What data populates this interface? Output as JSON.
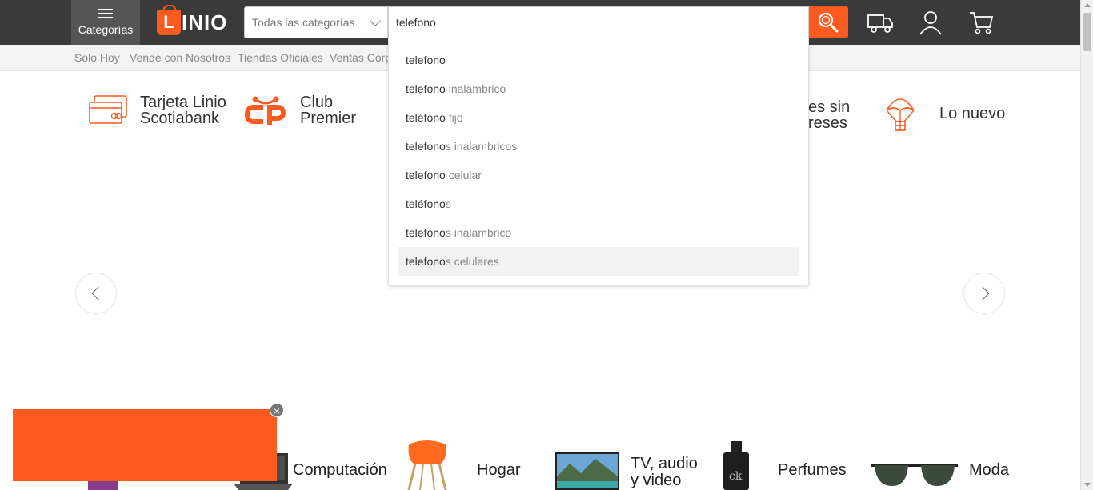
{
  "header": {
    "categories_label": "Categorías",
    "logo_text": "LINIO",
    "category_select": "Todas las categorías",
    "search_value": "telefono",
    "accent_color": "#ff5a1f"
  },
  "subnav": [
    "Solo Hoy",
    "Vende con Nosotros",
    "Tiendas Oficiales",
    "Ventas Corp"
  ],
  "promos": {
    "tarjeta": [
      "Tarjeta Linio",
      "Scotiabank"
    ],
    "club": [
      "Club",
      "Premier"
    ],
    "meses": [
      "es sin",
      "reses"
    ],
    "nuevo": "Lo nuevo"
  },
  "suggestions": [
    {
      "match": "telefono",
      "rest": ""
    },
    {
      "match": "telefono",
      "rest": " inalambrico"
    },
    {
      "match": "teléfono",
      "rest": " fijo"
    },
    {
      "match": "telefono",
      "rest": "s inalambricos"
    },
    {
      "match": "telefono",
      "rest": " celular"
    },
    {
      "match": "teléfono",
      "rest": "s"
    },
    {
      "match": "telefono",
      "rest": "s inalambrico"
    },
    {
      "match": "telefono",
      "rest": "s celulares"
    }
  ],
  "highlighted_suggestion": 7,
  "categories_row": [
    "Computación",
    "Hogar",
    "TV, audio",
    "y video",
    "Perfumes",
    "Moda"
  ]
}
